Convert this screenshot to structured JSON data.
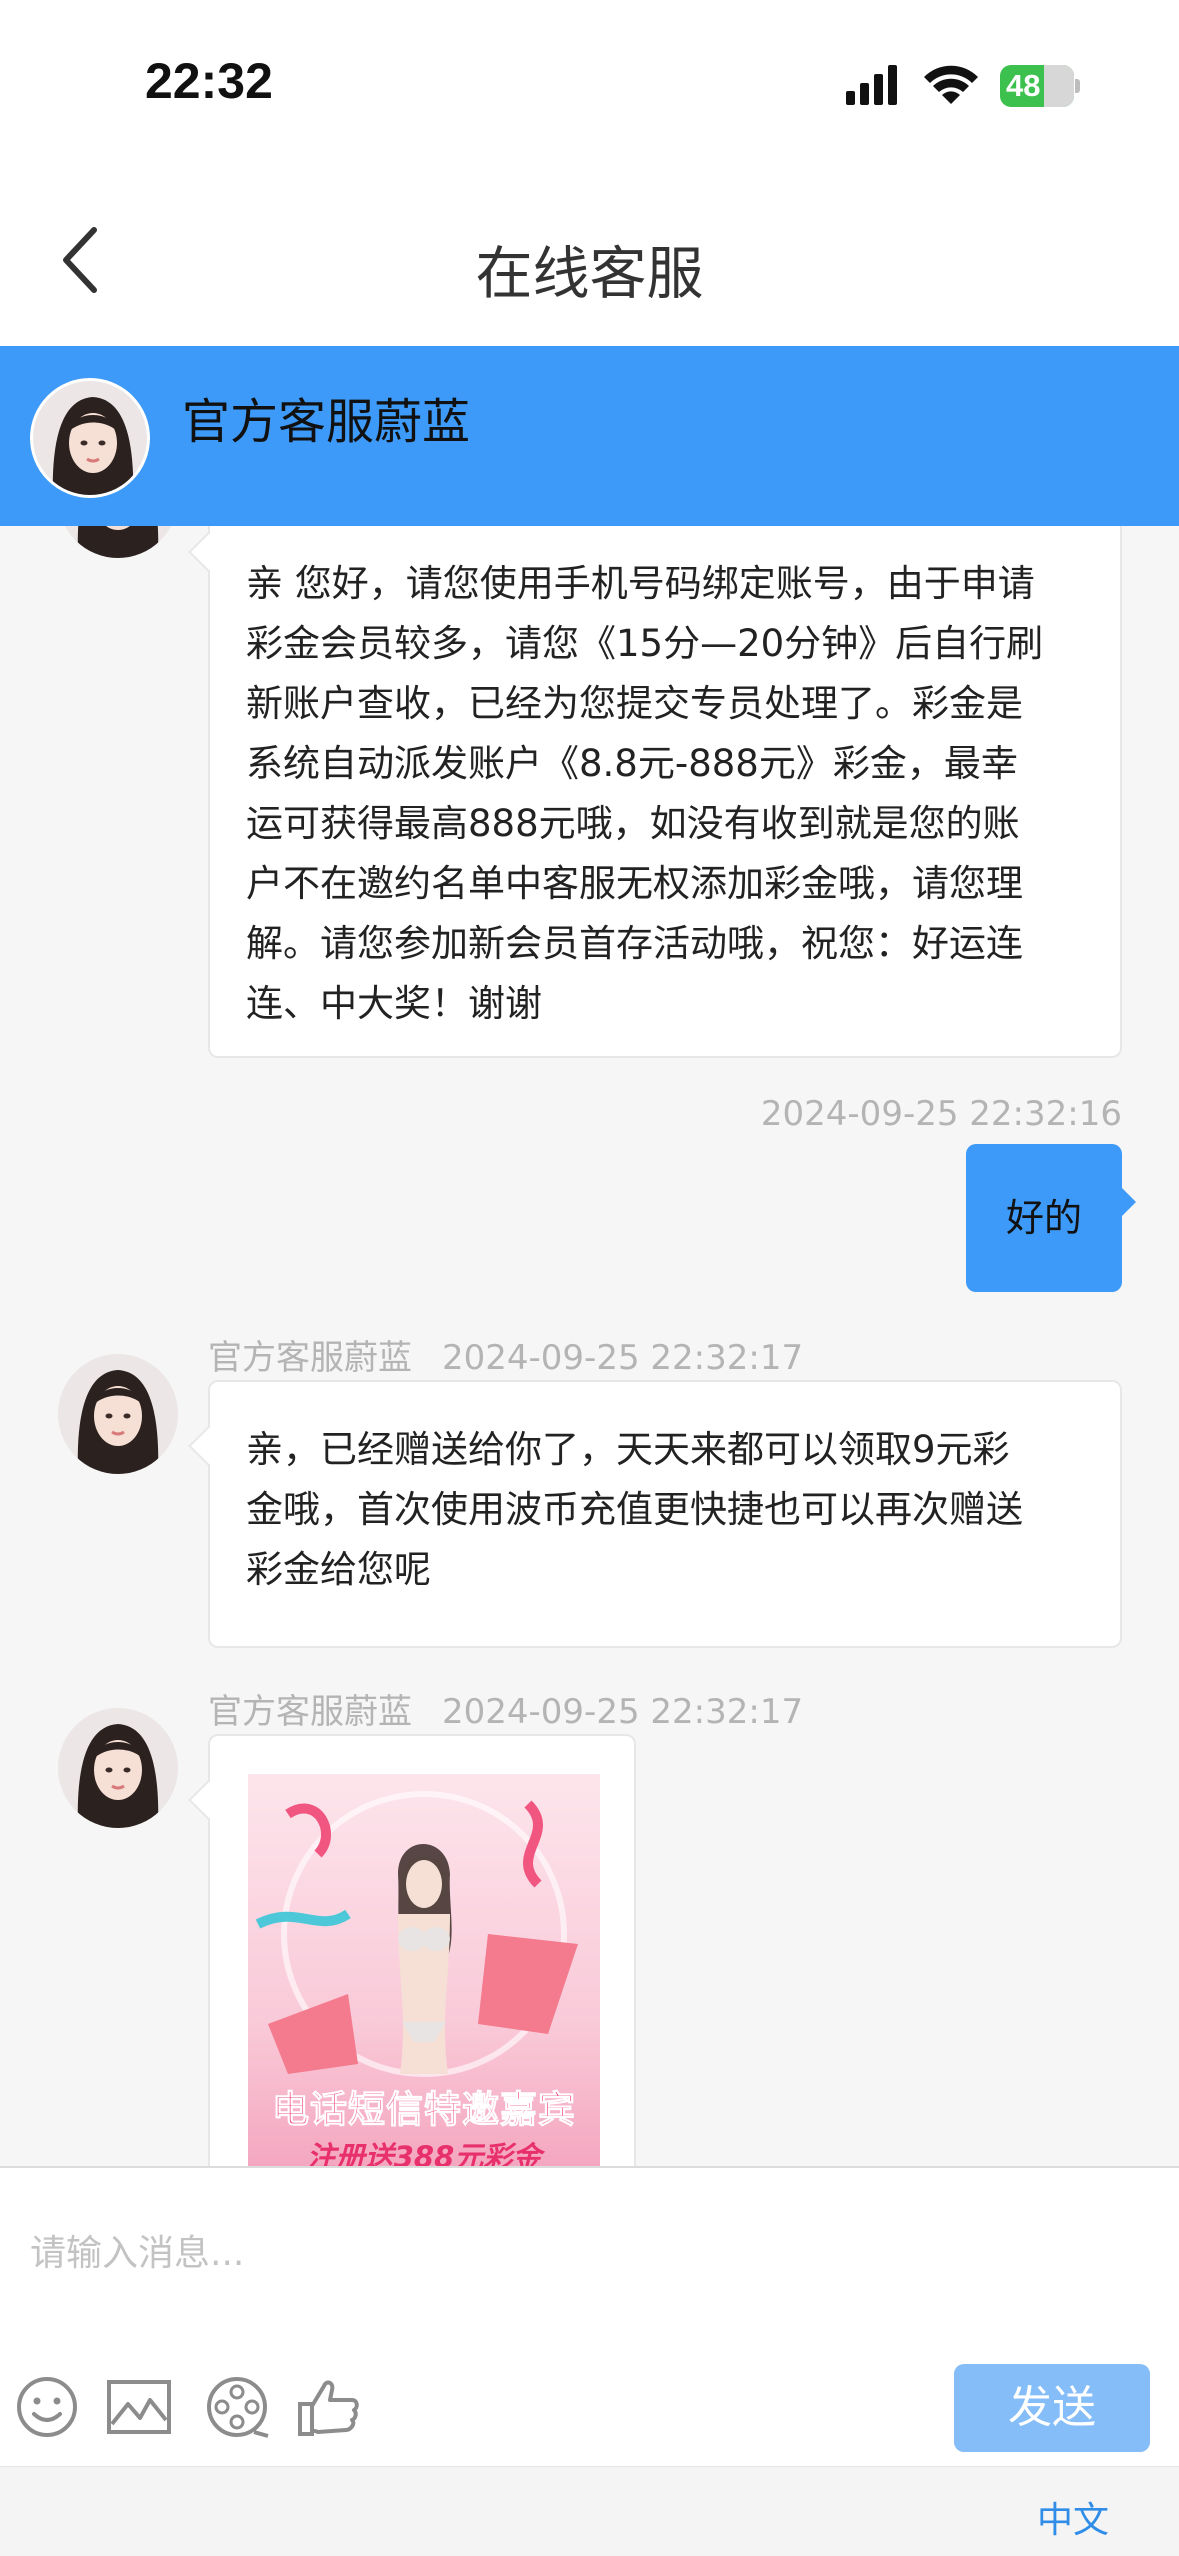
{
  "status_bar": {
    "time": "22:32",
    "battery": "48"
  },
  "nav": {
    "title": "在线客服",
    "back_icon": "chevron-left-icon"
  },
  "agent": {
    "name": "官方客服蔚蓝"
  },
  "messages": [
    {
      "from": "agent",
      "text": "亲 您好，请您使用手机号码绑定账号，由于申请彩金会员较多，请您《15分—20分钟》后自行刷新账户查收，已经为您提交专员处理了。彩金是系统自动派发账户《8.8元-888元》彩金，最幸运可获得最高888元哦，如没有收到就是您的账户不在邀约名单中客服无权添加彩金哦，请您理解。请您参加新会员首存活动哦，祝您：好运连连、中大奖！谢谢",
      "lines": [
        "亲 您好，请您使用手机号码绑定账号，由于申请",
        "彩金会员较多，请您《15分—20分钟》后自行刷",
        "新账户查收，已经为您提交专员处理了。彩金是",
        "系统自动派发账户《8.8元-888元》彩金，最幸",
        "运可获得最高888元哦，如没有收到就是您的账",
        "户不在邀约名单中客服无权添加彩金哦，请您理",
        "解。请您参加新会员首存活动哦，祝您：好运连",
        "连、中大奖！谢谢"
      ]
    },
    {
      "from": "self",
      "time": "2024-09-25 22:32:16",
      "text": "好的"
    },
    {
      "from": "agent",
      "name": "官方客服蔚蓝",
      "time": "2024-09-25 22:32:17",
      "lines": [
        "亲，已经赠送给你了，天天来都可以领取9元彩",
        "金哦，首次使用波币充值更快捷也可以再次赠送",
        "彩金给您呢"
      ]
    },
    {
      "from": "agent",
      "name": "官方客服蔚蓝",
      "time": "2024-09-25 22:32:17",
      "image": {
        "title": "电话短信特邀嘉宾",
        "subtitle": "注册送388元彩金"
      }
    }
  ],
  "input": {
    "placeholder": "请输入消息..."
  },
  "toolbar": {
    "icons": [
      "emoji-icon",
      "image-icon",
      "video-icon",
      "thumbs-up-icon"
    ],
    "send_label": "发送"
  },
  "footer": {
    "language": "中文"
  },
  "colors": {
    "accent": "#3d9af8",
    "send_disabled": "#84bdf8",
    "battery": "#3dc14e"
  }
}
